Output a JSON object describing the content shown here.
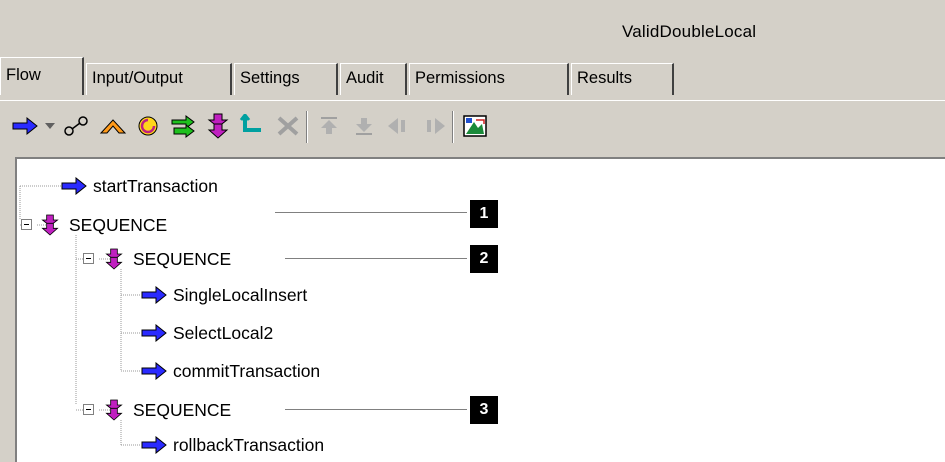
{
  "window": {
    "title": "ValidDoubleLocal"
  },
  "tabs": [
    {
      "label": "Flow",
      "active": true
    },
    {
      "label": "Input/Output"
    },
    {
      "label": "Settings"
    },
    {
      "label": "Audit"
    },
    {
      "label": "Permissions"
    },
    {
      "label": "Results"
    }
  ],
  "toolbar": {
    "icons": [
      "invoke-arrow-icon",
      "dropdown-icon",
      "map-icon",
      "branch-icon",
      "loop-icon",
      "repeat-icon",
      "sequence-icon",
      "exit-icon",
      "delete-icon",
      "move-up-icon",
      "move-down-icon",
      "indent-left-icon",
      "indent-right-icon",
      "properties-icon"
    ]
  },
  "tree": {
    "nodes": [
      {
        "label": "startTransaction",
        "type": "invoke"
      },
      {
        "label": "SEQUENCE",
        "type": "sequence",
        "callout": "1"
      },
      {
        "label": "SEQUENCE",
        "type": "sequence",
        "callout": "2"
      },
      {
        "label": "SingleLocalInsert",
        "type": "invoke"
      },
      {
        "label": "SelectLocal2",
        "type": "invoke"
      },
      {
        "label": "commitTransaction",
        "type": "invoke"
      },
      {
        "label": "SEQUENCE",
        "type": "sequence",
        "callout": "3"
      },
      {
        "label": "rollbackTransaction",
        "type": "invoke"
      }
    ]
  },
  "colors": {
    "invoke": "#2a2aff",
    "sequence": "#c020c0",
    "background": "#d4d0c8"
  }
}
